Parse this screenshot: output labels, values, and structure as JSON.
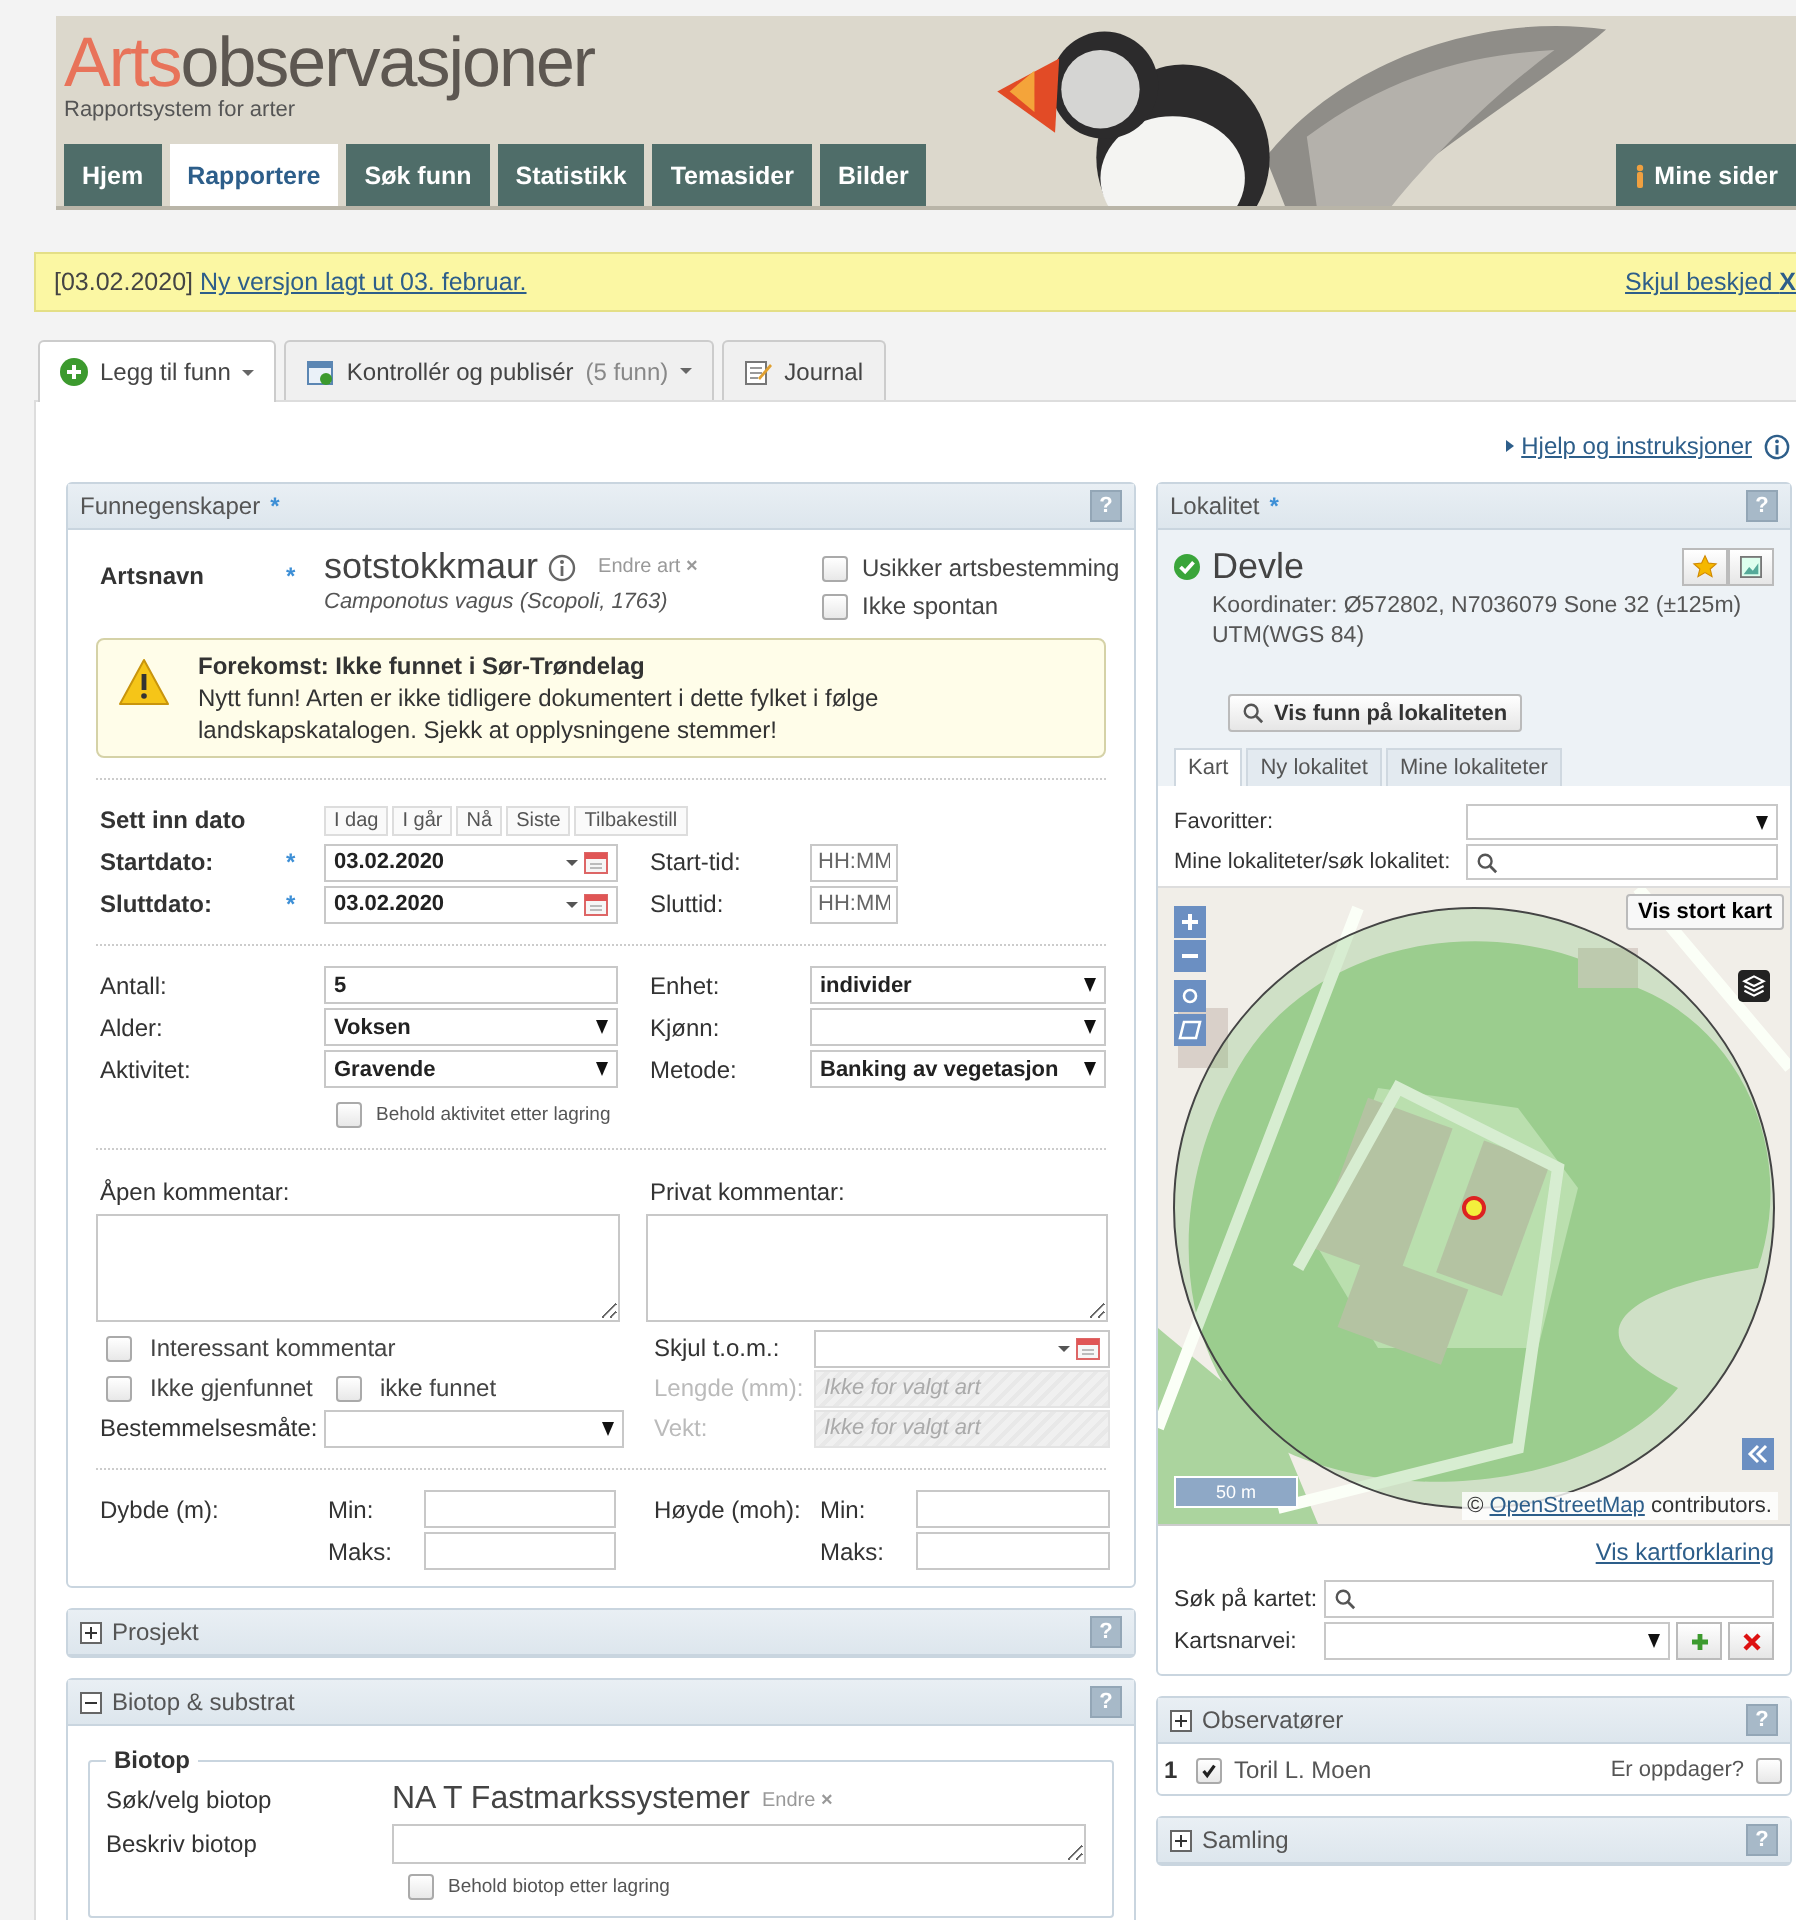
{
  "header": {
    "logo_accent": "Arts",
    "logo_rest": "observasjoner",
    "subtitle": "Rapportsystem for arter",
    "nav": [
      {
        "label": "Hjem",
        "selected": false
      },
      {
        "label": "Rapportere",
        "selected": true
      },
      {
        "label": "Søk funn",
        "selected": false
      },
      {
        "label": "Statistikk",
        "selected": false
      },
      {
        "label": "Temasider",
        "selected": false
      },
      {
        "label": "Bilder",
        "selected": false
      }
    ],
    "user_menu": "Mine sider"
  },
  "notice": {
    "date": "[03.02.2020]",
    "link": "Ny versjon lagt ut 03. februar.",
    "dismiss": "Skjul beskjed",
    "dismiss_mark": "X"
  },
  "tabs": [
    {
      "label": "Legg til funn",
      "kind": "add",
      "selected": true,
      "dropdown": true
    },
    {
      "label": "Kontrollér og publisér",
      "count": "(5 funn)",
      "kind": "check",
      "selected": false,
      "dropdown": true
    },
    {
      "label": "Journal",
      "kind": "journal",
      "selected": false,
      "dropdown": false
    }
  ],
  "help_link": "Hjelp og instruksjoner",
  "find_panel": {
    "title": "Funnegenskaper",
    "required": "*",
    "help": "?",
    "species": {
      "label": "Artsnavn",
      "required": "*",
      "name": "sotstokkmaur",
      "scientific": "Camponotus vagus (Scopoli, 1763)",
      "change": "Endre art",
      "remove": "×"
    },
    "species_checks": [
      {
        "label": "Usikker artsbestemming",
        "checked": false
      },
      {
        "label": "Ikke spontan",
        "checked": false
      }
    ],
    "warning": {
      "title": "Forekomst: Ikke funnet i Sør-Trøndelag",
      "text": "Nytt funn! Arten er ikke tidligere dokumentert i dette fylket i følge landskapskatalogen. Sjekk at opplysningene stemmer!"
    },
    "date_label": "Sett inn dato",
    "date_buttons": [
      "I dag",
      "I går",
      "Nå",
      "Siste",
      "Tilbakestill"
    ],
    "dates": [
      {
        "label": "Startdato:",
        "required": "*",
        "value": "03.02.2020",
        "time_label": "Start-tid:",
        "time_placeholder": "HH:MM"
      },
      {
        "label": "Sluttdato:",
        "required": "*",
        "value": "03.02.2020",
        "time_label": "Sluttid:",
        "time_placeholder": "HH:MM"
      }
    ],
    "fields": [
      {
        "label": "Antall:",
        "kind": "input",
        "value": "5"
      },
      {
        "label": "Enhet:",
        "kind": "select",
        "value": "individer"
      },
      {
        "label": "Alder:",
        "kind": "select",
        "value": "Voksen"
      },
      {
        "label": "Kjønn:",
        "kind": "select"
      },
      {
        "label": "Aktivitet:",
        "kind": "select",
        "value": "Gravende"
      },
      {
        "label": "Metode:",
        "kind": "select",
        "value": "Banking av vegetasjon"
      }
    ],
    "keep_activity": {
      "label": "Behold aktivitet etter lagring",
      "checked": false
    },
    "comments": [
      {
        "label": "Åpen kommentar:"
      },
      {
        "label": "Privat kommentar:"
      }
    ],
    "flags": [
      {
        "label": "Interessant kommentar",
        "checked": false
      },
      {
        "label": "Ikke gjenfunnet",
        "checked": false
      },
      {
        "label": "ikke funnet",
        "checked": false
      }
    ],
    "method": {
      "label": "Bestemmelsesmåte:"
    },
    "extras": [
      {
        "label": "Skjul t.o.m.:",
        "kind": "date",
        "disabled": false
      },
      {
        "label": "Lengde (mm):",
        "kind": "input",
        "disabled": true,
        "placeholder": "Ikke for valgt art"
      },
      {
        "label": "Vekt:",
        "kind": "input",
        "disabled": true,
        "placeholder": "Ikke for valgt art"
      }
    ],
    "ranges": [
      {
        "label": "Dybde (m):",
        "min": "Min:",
        "max": "Maks:"
      },
      {
        "label": "Høyde (moh):",
        "min": "Min:",
        "max": "Maks:"
      }
    ]
  },
  "sections": [
    {
      "title": "Prosjekt",
      "expanded": false,
      "help": "?"
    },
    {
      "title": "Biotop & substrat",
      "expanded": true,
      "help": "?"
    }
  ],
  "biotope": {
    "legend": "Biotop",
    "search_label": "Søk/velg biotop",
    "value": "NA T Fastmarkssystemer",
    "change": "Endre",
    "remove": "×",
    "describe_label": "Beskriv biotop",
    "keep": {
      "label": "Behold biotop etter lagring",
      "checked": false
    }
  },
  "locality": {
    "title": "Lokalitet",
    "required": "*",
    "help": "?",
    "name": "Devle",
    "verified": true,
    "coordinates": "Koordinater: Ø572802, N7036079 Sone 32 (±125m) UTM(WGS 84)",
    "show_button": "Vis funn på lokaliteten",
    "tabs": [
      {
        "label": "Kart",
        "selected": true
      },
      {
        "label": "Ny lokalitet",
        "selected": false
      },
      {
        "label": "Mine lokaliteter",
        "selected": false
      }
    ],
    "favorites_label": "Favoritter:",
    "search_label": "Mine lokaliteter/søk lokalitet:",
    "map": {
      "large_button": "Vis stort kart",
      "scale": "50 m",
      "attribution_prefix": "©",
      "attribution_link": "OpenStreetMap",
      "attribution_suffix": "contributors."
    },
    "legend_link": "Vis kartforklaring",
    "map_search_label": "Søk på kartet:",
    "shortcut_label": "Kartsnarvei:"
  },
  "observers": {
    "title": "Observatører",
    "expanded": false,
    "help": "?",
    "rows": [
      {
        "number": "1",
        "name": "Toril L. Moen",
        "checked": true,
        "discoverer_label": "Er oppdager?",
        "discoverer": false
      }
    ]
  },
  "collection": {
    "title": "Samling",
    "expanded": false,
    "help": "?"
  }
}
